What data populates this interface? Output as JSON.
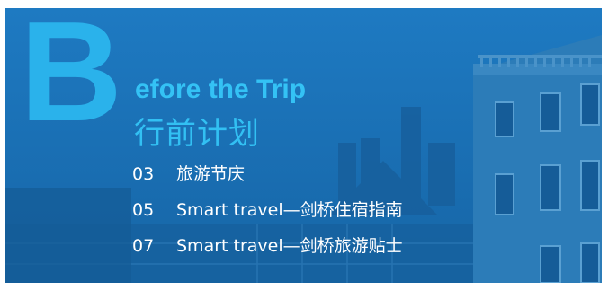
{
  "header": {
    "big_letter": "B",
    "title_en": "efore the Trip",
    "title_cn": "行前计划"
  },
  "toc": [
    {
      "num": "03",
      "label": "旅游节庆"
    },
    {
      "num": "05",
      "label": "Smart travel—剑桥住宿指南"
    },
    {
      "num": "07",
      "label": "Smart travel—剑桥旅游贴士"
    }
  ],
  "colors": {
    "overlay": "#1a6fb3",
    "accent": "#2bb6ee",
    "text": "#ffffff"
  }
}
